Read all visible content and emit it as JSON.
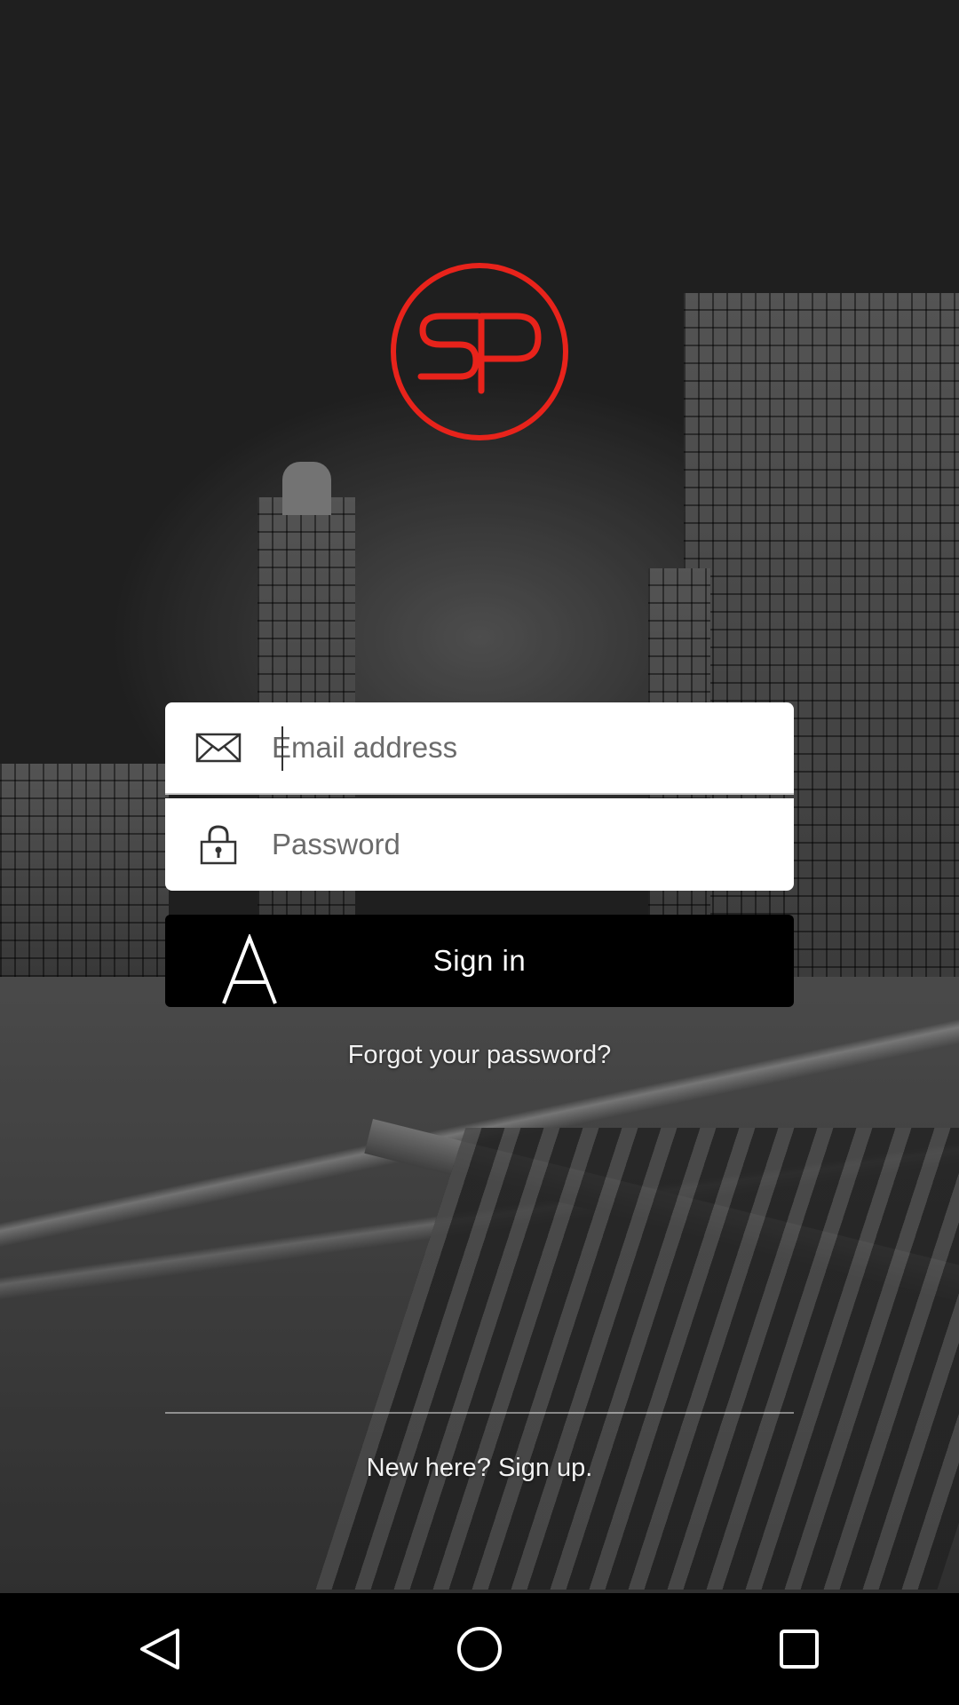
{
  "login": {
    "logo_text": "SP",
    "email_placeholder": "Email address",
    "password_placeholder": "Password",
    "signin_label": "Sign in",
    "forgot_password_label": "Forgot your password?",
    "signup_label": "New here? Sign up."
  },
  "icons": {
    "email": "envelope-icon",
    "password": "padlock-icon",
    "signin": "letter-a-icon",
    "nav_back": "back-triangle-icon",
    "nav_home": "home-circle-icon",
    "nav_recents": "recents-square-icon"
  },
  "colors": {
    "logo": "#e8231b",
    "field_background": "#ffffff",
    "button_background": "#000000",
    "text_light": "#ffffff"
  }
}
